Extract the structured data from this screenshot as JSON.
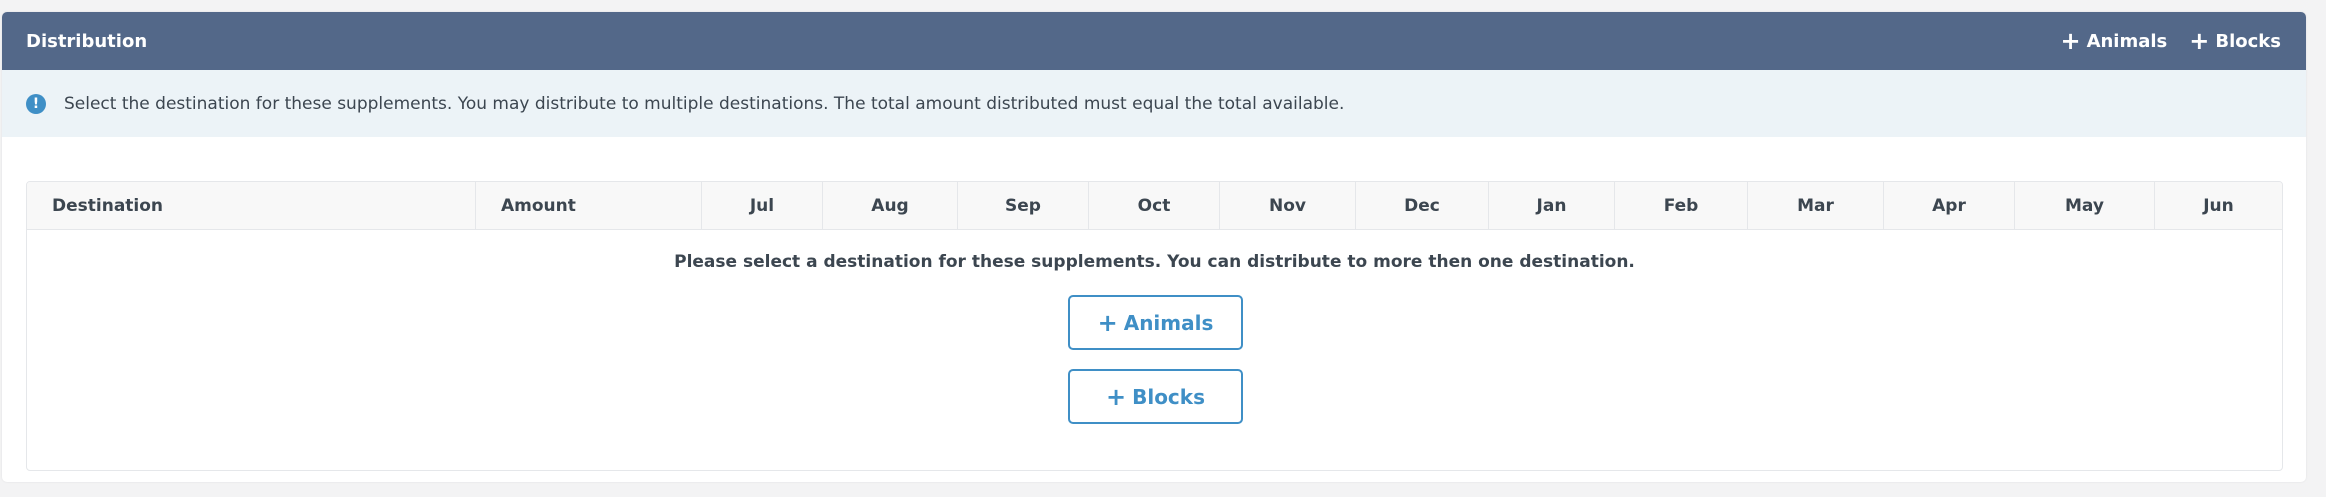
{
  "header": {
    "title": "Distribution",
    "actions": [
      {
        "icon": "plus-icon",
        "label": "Animals"
      },
      {
        "icon": "plus-icon",
        "label": "Blocks"
      }
    ],
    "background": "#536889"
  },
  "info": {
    "icon": "info-icon",
    "text": "Select the destination for these supplements. You may distribute to multiple destinations. The total amount distributed must equal the total available."
  },
  "table": {
    "columns": [
      "Destination",
      "Amount",
      "Jul",
      "Aug",
      "Sep",
      "Oct",
      "Nov",
      "Dec",
      "Jan",
      "Feb",
      "Mar",
      "Apr",
      "May",
      "Jun"
    ],
    "empty_message": "Please select a destination for these supplements. You can distribute to more then one destination.",
    "buttons": [
      {
        "icon": "plus-icon",
        "label": "Animals"
      },
      {
        "icon": "plus-icon",
        "label": "Blocks"
      }
    ]
  },
  "colors": {
    "accent": "#3f8fc6",
    "info_bg": "#ecf3f7"
  }
}
